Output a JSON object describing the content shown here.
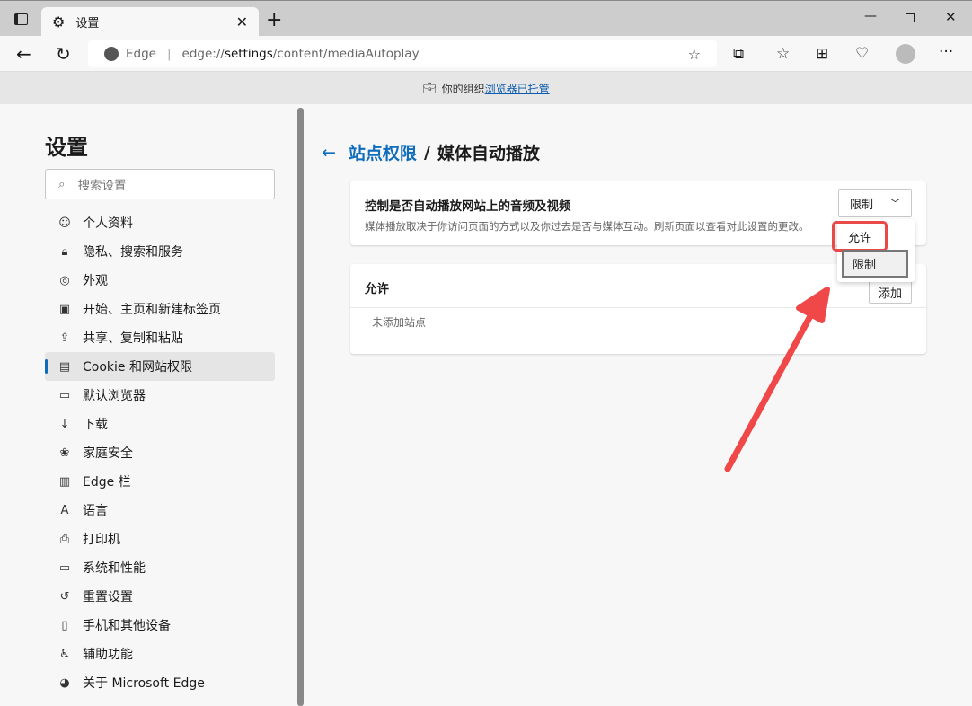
{
  "browser": {
    "tab_title": "设置",
    "brand": "Edge",
    "url_prefix": "edge://",
    "url_host": "settings",
    "url_path": "/content/mediaAutoplay"
  },
  "infobar": {
    "text": "你的组织",
    "link": "浏览器已托管"
  },
  "sidebar": {
    "title": "设置",
    "search_placeholder": "搜索设置",
    "items": [
      {
        "label": "个人资料",
        "icon": "profile-icon"
      },
      {
        "label": "隐私、搜索和服务",
        "icon": "lock-icon"
      },
      {
        "label": "外观",
        "icon": "palette-icon"
      },
      {
        "label": "开始、主页和新建标签页",
        "icon": "home-icon"
      },
      {
        "label": "共享、复制和粘贴",
        "icon": "share-icon"
      },
      {
        "label": "Cookie 和网站权限",
        "icon": "site-permissions-icon",
        "selected": true
      },
      {
        "label": "默认浏览器",
        "icon": "browser-icon"
      },
      {
        "label": "下载",
        "icon": "download-icon"
      },
      {
        "label": "家庭安全",
        "icon": "family-icon"
      },
      {
        "label": "Edge 栏",
        "icon": "edge-bar-icon"
      },
      {
        "label": "语言",
        "icon": "language-icon"
      },
      {
        "label": "打印机",
        "icon": "printer-icon"
      },
      {
        "label": "系统和性能",
        "icon": "laptop-icon"
      },
      {
        "label": "重置设置",
        "icon": "reset-icon"
      },
      {
        "label": "手机和其他设备",
        "icon": "phone-icon"
      },
      {
        "label": "辅助功能",
        "icon": "accessibility-icon"
      },
      {
        "label": "关于 Microsoft Edge",
        "icon": "edge-logo-icon"
      }
    ]
  },
  "main": {
    "breadcrumb_parent": "站点权限",
    "breadcrumb_sep": "/",
    "breadcrumb_current": "媒体自动播放",
    "setting_title": "控制是否自动播放网站上的音频及视频",
    "setting_desc": "媒体播放取决于你访问页面的方式以及你过去是否与媒体互动。刷新页面以查看对此设置的更改。",
    "dropdown_value": "限制",
    "dropdown_options": [
      "允许",
      "限制"
    ],
    "allow_title": "允许",
    "add_button": "添加",
    "empty_text": "未添加站点"
  },
  "colors": {
    "accent": "#0f6cbd",
    "highlight": "#e84a4a"
  }
}
